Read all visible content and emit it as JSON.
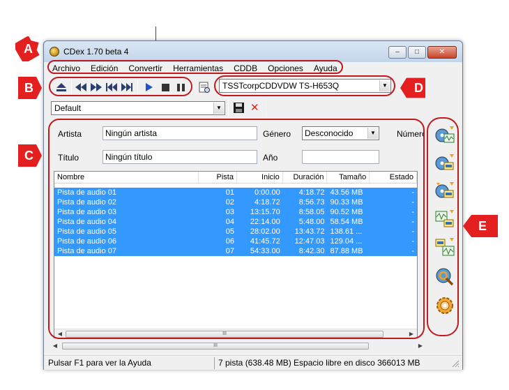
{
  "window": {
    "title": "CDex 1.70 beta 4",
    "controls": {
      "minimize": "–",
      "maximize": "□",
      "close": "✕"
    }
  },
  "menu": [
    "Archivo",
    "Edición",
    "Convertir",
    "Herramientas",
    "CDDB",
    "Opciones",
    "Ayuda"
  ],
  "toolbar": {
    "buttons": [
      "eject-icon",
      "rewind-icon",
      "fast-forward-icon",
      "previous-track-icon",
      "next-track-icon",
      "play-icon",
      "stop-icon",
      "pause-icon",
      "cd-info-icon"
    ],
    "drive": "TSSTcorpCDDVDW TS-H653Q"
  },
  "profile": {
    "value": "Default",
    "save_icon": "floppy-disk-icon",
    "delete_icon": "red-x-icon"
  },
  "info": {
    "artist_label": "Artista",
    "artist_value": "Ningún artista",
    "title_label": "Título",
    "title_value": "Ningún título",
    "genre_label": "Género",
    "genre_value": "Desconocido",
    "year_label": "Año",
    "year_value": "",
    "number_label": "Número"
  },
  "tracklist": {
    "columns": [
      "Nombre",
      "Pista",
      "Inicio",
      "Duración",
      "Tamaño",
      "Estado"
    ],
    "rows": [
      [
        "Pista de audio 01",
        "01",
        "0:00.00",
        "4:18.72",
        "43.56 MB",
        "-"
      ],
      [
        "Pista de audio 02",
        "02",
        "4:18.72",
        "8:56.73",
        "90.33 MB",
        "-"
      ],
      [
        "Pista de audio 03",
        "03",
        "13:15.70",
        "8:58.05",
        "90.52 MB",
        "-"
      ],
      [
        "Pista de audio 04",
        "04",
        "22:14.00",
        "5:48.00",
        "58.54 MB",
        "-"
      ],
      [
        "Pista de audio 05",
        "05",
        "28:02.00",
        "13:43.72",
        "138.61 ...",
        "-"
      ],
      [
        "Pista de audio 06",
        "06",
        "41:45.72",
        "12:47.03",
        "129.04 ...",
        "-"
      ],
      [
        "Pista de audio 07",
        "07",
        "54:33.00",
        "8:42.30",
        "87.88 MB",
        "-"
      ]
    ],
    "scroll_thumb": "III"
  },
  "side_buttons": [
    "extract-to-wav-icon",
    "extract-to-mp3-icon",
    "convert-cd-icon",
    "wav-to-mp3-icon",
    "mp3-to-wav-icon",
    "cddb-query-icon",
    "settings-gear-icon"
  ],
  "status": {
    "help": "Pulsar F1 para ver la Ayuda",
    "info": "7 pista (638.48 MB) Espacio libre en disco 366013 MB"
  },
  "annotations": [
    "A",
    "B",
    "C",
    "D",
    "E"
  ],
  "colors": {
    "selection": "#3399ff",
    "annotation": "#c0191e",
    "badge": "#e3201f"
  }
}
